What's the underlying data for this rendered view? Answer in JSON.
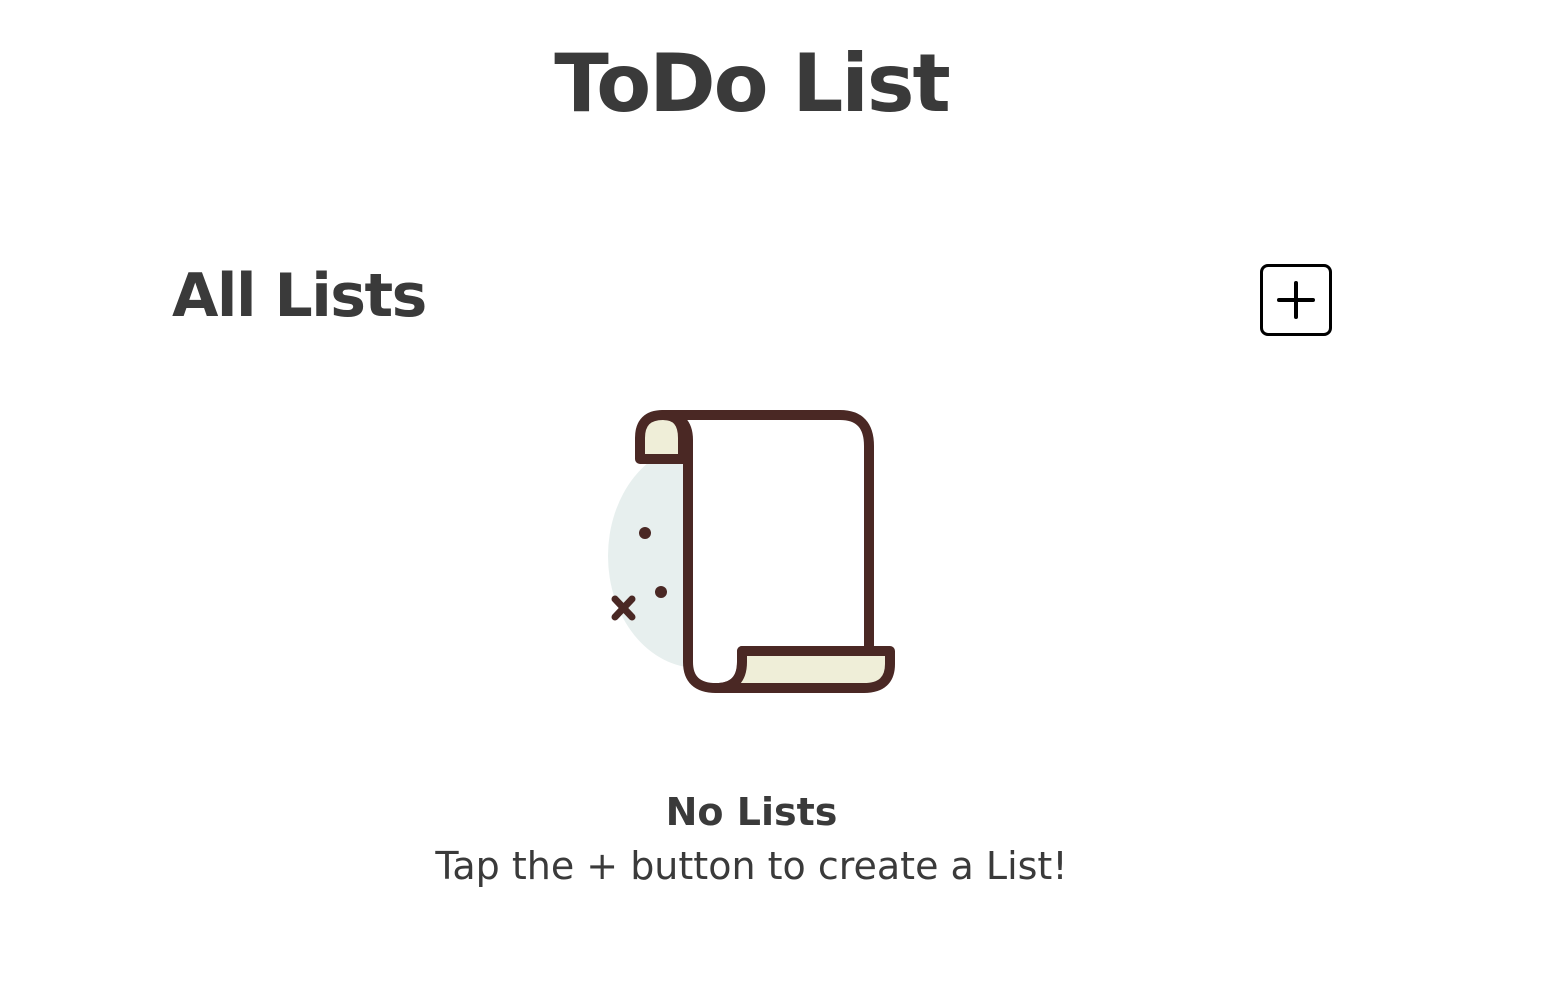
{
  "app": {
    "title": "ToDo List"
  },
  "lists_section": {
    "title": "All Lists",
    "add_button_icon": "plus-square-icon"
  },
  "empty_state": {
    "illustration": "scroll-icon",
    "title": "No Lists",
    "subtitle": "Tap the + button to create a List!"
  },
  "colors": {
    "text": "#3a3a3a",
    "illustration_outline": "#4a2824",
    "illustration_paper": "#efeed8",
    "illustration_backdrop": "#e7efee"
  }
}
